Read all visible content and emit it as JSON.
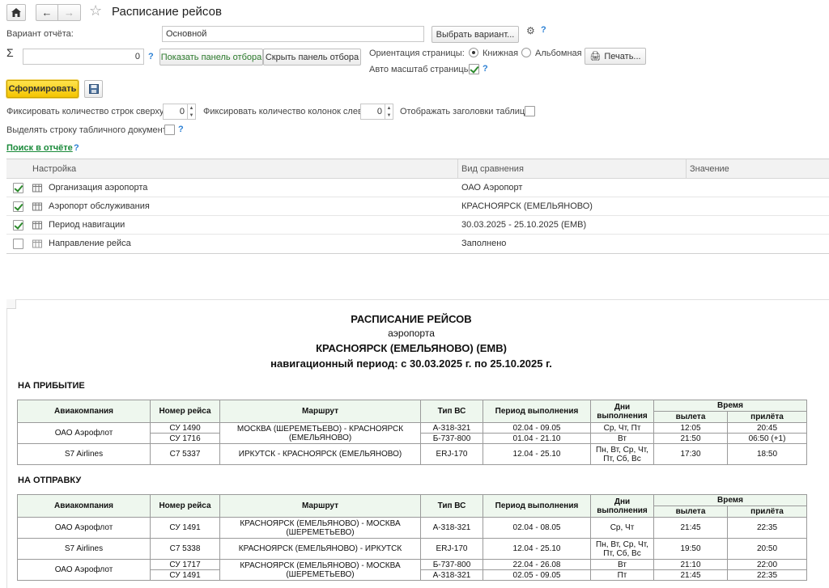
{
  "window": {
    "title": "Расписание рейсов"
  },
  "form": {
    "variant_label": "Вариант отчёта:",
    "variant_value": "Основной",
    "choose_variant_button": "Выбрать вариант...",
    "sum_value": "0",
    "show_filter_button": "Показать панель отбора",
    "hide_filter_button": "Скрыть панель отбора",
    "orientation_label": "Ориентация страницы:",
    "orientation_portrait": "Книжная",
    "orientation_landscape": "Альбомная",
    "print_button": "Печать...",
    "auto_scale_label": "Авто масштаб страницы:",
    "generate_button": "Сформировать",
    "fix_rows_label": "Фиксировать количество строк сверху:",
    "fix_rows_value": "0",
    "fix_cols_label": "Фиксировать количество колонок слева:",
    "fix_cols_value": "0",
    "show_headers_label": "Отображать заголовки таблицы:",
    "highlight_row_label": "Выделять строку табличного документа:",
    "search_link": "Поиск в отчёте",
    "help_mark": "?"
  },
  "settings": {
    "headers": [
      "Настройка",
      "Вид сравнения",
      "Значение"
    ],
    "rows": [
      {
        "checked": true,
        "name": "Организация аэропорта",
        "value": "ОАО Аэропорт"
      },
      {
        "checked": true,
        "name": "Аэропорт обслуживания",
        "value": "КРАСНОЯРСК (ЕМЕЛЬЯНОВО)"
      },
      {
        "checked": true,
        "name": "Период навигации",
        "value": "30.03.2025 - 25.10.2025 (EMB)"
      },
      {
        "checked": false,
        "name": "Направление рейса",
        "value": "Заполнено"
      }
    ]
  },
  "report": {
    "title1": "РАСПИСАНИЕ РЕЙСОВ",
    "title2": "аэропорта",
    "title3": "КРАСНОЯРСК (ЕМЕЛЬЯНОВО) (EMB)",
    "title4": "навигационный период: с 30.03.2025 г. по 25.10.2025 г.",
    "arrival_section": "НА ПРИБЫТИЕ",
    "departure_section": "НА ОТПРАВКУ",
    "columns": {
      "airline": "Авиакомпания",
      "flight": "Номер рейса",
      "route": "Маршрут",
      "aircraft": "Тип ВС",
      "period": "Период выполнения",
      "days": "Дни выполнения",
      "time": "Время",
      "dep": "вылета",
      "arr": "прилёта"
    },
    "arrival": [
      {
        "airline": "ОАО Аэрофлот",
        "flight": "СУ 1490",
        "route": "МОСКВА (ШЕРЕМЕТЬЕВО) - КРАСНОЯРСК (ЕМЕЛЬЯНОВО)",
        "aircraft": "А-318-321",
        "period": "02.04 - 09.05",
        "days": "Ср, Чт, Пт",
        "dep": "12:05",
        "arr": "20:45"
      },
      {
        "flight": "СУ 1716",
        "aircraft": "Б-737-800",
        "period": "01.04 - 21.10",
        "days": "Вт",
        "dep": "21:50",
        "arr": "06:50 (+1)"
      },
      {
        "airline": "S7 Airlines",
        "flight": "С7 5337",
        "route": "ИРКУТСК - КРАСНОЯРСК (ЕМЕЛЬЯНОВО)",
        "aircraft": "ERJ-170",
        "period": "12.04 - 25.10",
        "days": "Пн, Вт, Ср, Чт, Пт, Сб, Вс",
        "dep": "17:30",
        "arr": "18:50"
      }
    ],
    "departure": [
      {
        "airline": "ОАО Аэрофлот",
        "flight": "СУ 1491",
        "route": "КРАСНОЯРСК (ЕМЕЛЬЯНОВО) - МОСКВА (ШЕРЕМЕТЬЕВО)",
        "aircraft": "А-318-321",
        "period": "02.04 - 08.05",
        "days": "Ср, Чт",
        "dep": "21:45",
        "arr": "22:35"
      },
      {
        "airline": "S7 Airlines",
        "flight": "С7 5338",
        "route": "КРАСНОЯРСК (ЕМЕЛЬЯНОВО) - ИРКУТСК",
        "aircraft": "ERJ-170",
        "period": "12.04 - 25.10",
        "days": "Пн, Вт, Ср, Чт, Пт, Сб, Вс",
        "dep": "19:50",
        "arr": "20:50"
      },
      {
        "airline": "ОАО Аэрофлот",
        "flight": "СУ 1717",
        "route": "КРАСНОЯРСК (ЕМЕЛЬЯНОВО) - МОСКВА (ШЕРЕМЕТЬЕВО)",
        "aircraft": "Б-737-800",
        "period": "22.04 - 26.08",
        "days": "Вт",
        "dep": "21:10",
        "arr": "22:00"
      },
      {
        "flight": "СУ 1491",
        "aircraft": "А-318-321",
        "period": "02.05 - 09.05",
        "days": "Пт",
        "dep": "21:45",
        "arr": "22:35"
      }
    ]
  }
}
